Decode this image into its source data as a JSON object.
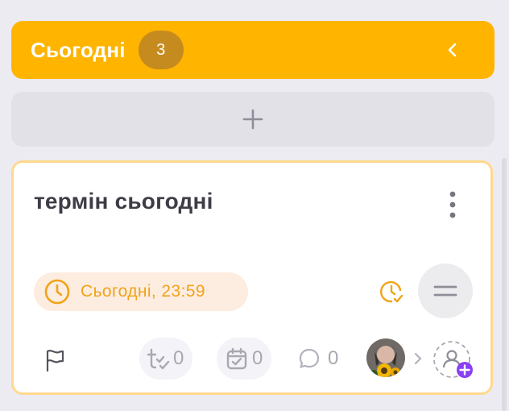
{
  "column": {
    "title": "Сьогодні",
    "count": "3",
    "accent_color": "#ffb400",
    "collapse_icon": "chevron-left-icon"
  },
  "add_task": {
    "icon": "plus-icon"
  },
  "task": {
    "title": "термін сьогодні",
    "due": "Сьогодні, 23:59",
    "due_color": "#f0a417",
    "subtasks": "0",
    "checklists": "0",
    "comments": "0",
    "icons": [
      "clock-icon",
      "timer-icon",
      "priority-icon",
      "flag-icon",
      "subtasks-icon",
      "calendar-check-icon",
      "comment-icon",
      "chevron-right-icon",
      "add-user-icon"
    ]
  }
}
